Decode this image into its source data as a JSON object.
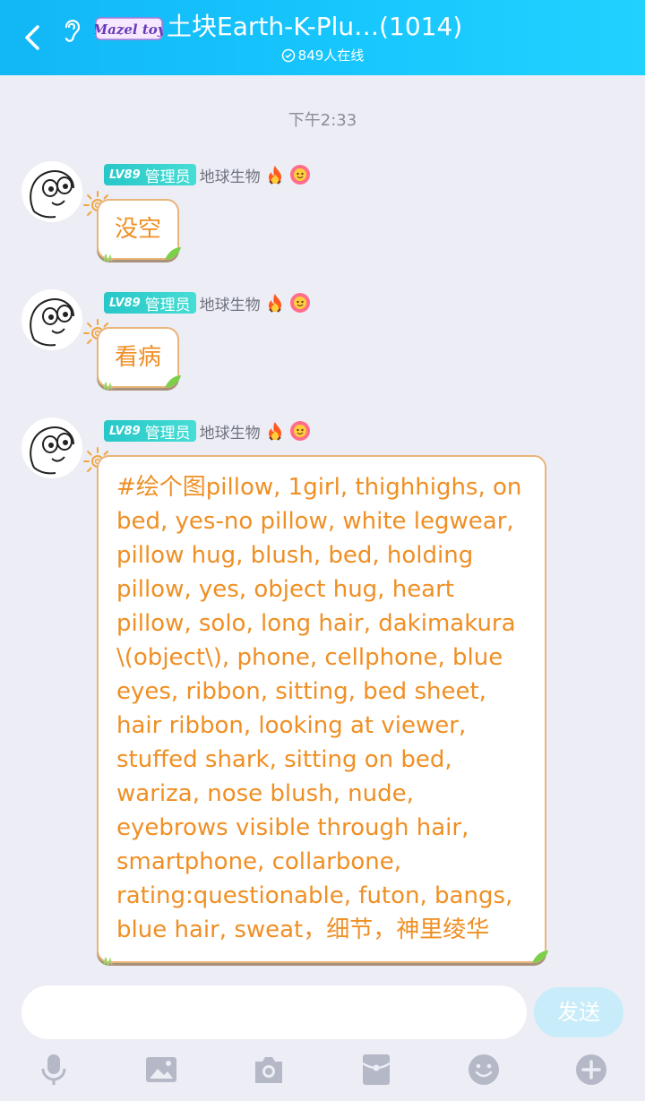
{
  "header": {
    "logo_text": "Mazel tov",
    "title": "土块Earth-K-Plu…(1014)",
    "online": "849人在线"
  },
  "chat": {
    "timestamp": "下午2:33",
    "messages": [
      {
        "level": "LV89",
        "role": "管理员",
        "nickname": "地球生物",
        "text": "没空"
      },
      {
        "level": "LV89",
        "role": "管理员",
        "nickname": "地球生物",
        "text": "看病"
      },
      {
        "level": "LV89",
        "role": "管理员",
        "nickname": "地球生物",
        "text": "#绘个图pillow, 1girl, thighhighs, on bed, yes-no pillow, white legwear, pillow hug, blush, bed, holding pillow, yes, object hug, heart pillow, solo, long hair, dakimakura \\(object\\), phone, cellphone, blue eyes, ribbon, sitting, bed sheet, hair ribbon, looking at viewer, stuffed shark, sitting on bed, wariza, nose blush, nude, eyebrows visible through hair, smartphone, collarbone, rating:questionable, futon, bangs, blue hair, sweat，细节，神里绫华"
      }
    ]
  },
  "input": {
    "placeholder": "",
    "send_label": "发送"
  },
  "toolbar": {
    "icons": [
      "microphone-icon",
      "image-icon",
      "camera-icon",
      "red-packet-icon",
      "emoji-icon",
      "plus-icon"
    ]
  },
  "colors": {
    "header": "#18c8ff",
    "bubble_text": "#ef8f24",
    "bubble_border": "#e9b57a",
    "badge": "#27c7c8",
    "send_button": "#c8ecf9",
    "background": "#ecedf5"
  }
}
